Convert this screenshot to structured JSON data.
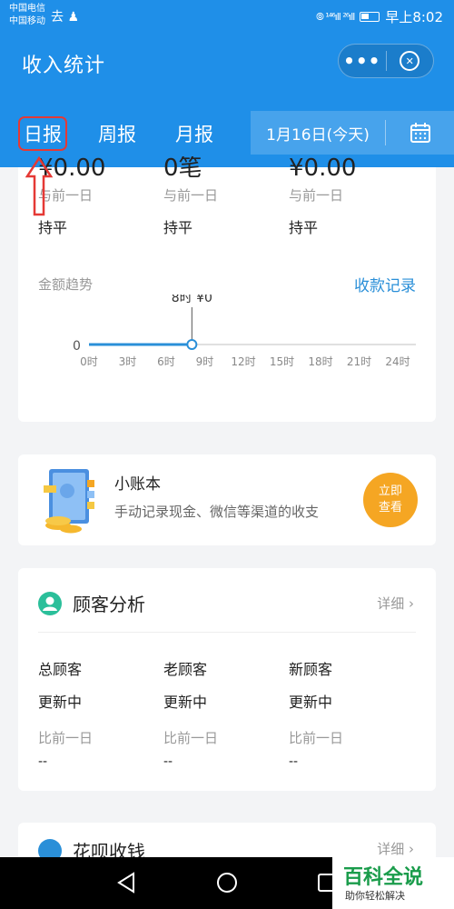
{
  "status_bar": {
    "carrier_1": "中国电信",
    "carrier_2": "中国移动",
    "left_icons": "去 ♟",
    "signal": "⦾ ¹⁴⁶ıll ²⁶ıll",
    "time": "早上8:02"
  },
  "header": {
    "title": "收入统计",
    "more_label": "•••",
    "tabs": [
      "日报",
      "周报",
      "月报"
    ],
    "date": "1月16日(今天)"
  },
  "stats": {
    "columns": [
      {
        "top": "¥0.00",
        "compare": "与前一日",
        "value": "持平"
      },
      {
        "top": "0笔",
        "compare": "与前一日",
        "value": "持平"
      },
      {
        "top": "¥0.00",
        "compare": "与前一日",
        "value": "持平"
      }
    ],
    "trend_title": "金额趋势",
    "trend_link": "收款记录"
  },
  "chart_data": {
    "type": "line",
    "x": [
      0,
      3,
      6,
      9,
      12,
      15,
      18,
      21,
      24
    ],
    "tick_labels": [
      "0时",
      "3时",
      "6时",
      "9时",
      "12时",
      "15时",
      "18时",
      "21时",
      "24时"
    ],
    "y_tick": "0",
    "series": [
      {
        "x": [
          0,
          8
        ],
        "values": [
          0,
          0
        ]
      }
    ],
    "highlight": {
      "x": 8,
      "label": "8时 ¥0"
    },
    "colors": {
      "line": "#2a8fd8",
      "axis": "#e0e0e0"
    }
  },
  "ledger": {
    "title": "小账本",
    "desc": "手动记录现金、微信等渠道的收支",
    "button_line1": "立即",
    "button_line2": "查看"
  },
  "customers": {
    "title": "顾客分析",
    "detail": "详细 ›",
    "columns": [
      {
        "label": "总顾客",
        "value": "更新中",
        "compare": "比前一日",
        "dash": "--"
      },
      {
        "label": "老顾客",
        "value": "更新中",
        "compare": "比前一日",
        "dash": "--"
      },
      {
        "label": "新顾客",
        "value": "更新中",
        "compare": "比前一日",
        "dash": "--"
      }
    ]
  },
  "huabei": {
    "title": "花呗收钱",
    "detail": "详细 ›"
  },
  "watermark": {
    "main": "百科全说",
    "sub": "助你轻松解决"
  },
  "colors": {
    "brand": "#1f8fe8",
    "accent": "#2a8fd8",
    "annotation": "#e53935",
    "button": "#f5a623"
  }
}
